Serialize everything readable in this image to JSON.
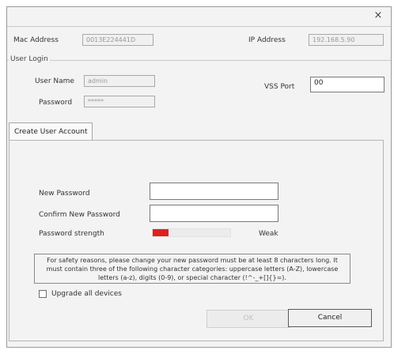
{
  "dialog": {
    "close_glyph": "×"
  },
  "device": {
    "mac_label": "Mac Address",
    "mac_value": "0013E224441D",
    "ip_label": "IP Address",
    "ip_value": "192.168.5.90"
  },
  "login": {
    "group_title": "User Login",
    "username_label": "User Name",
    "username_value": "admin",
    "password_label": "Password",
    "password_value": "*****",
    "vss_port_label": "VSS Port",
    "vss_port_value": "00"
  },
  "tab": {
    "label": "Create User Account"
  },
  "form": {
    "new_password_label": "New Password",
    "new_password_value": "",
    "confirm_password_label": "Confirm New Password",
    "confirm_password_value": "",
    "strength_label": "Password strength",
    "strength_text": "Weak",
    "strength_fraction": 0.2,
    "strength_color": "#e02020"
  },
  "notice": {
    "text": "For safety reasons, please change your new password must be at least 8 characters long. It must contain three of the following character categories: uppercase letters (A-Z), lowercase letters (a-z), digits (0-9), or special character (!^-_+[]{}=)."
  },
  "upgrade": {
    "label": "Upgrade all devices",
    "checked": false
  },
  "buttons": {
    "ok": "OK",
    "cancel": "Cancel"
  }
}
